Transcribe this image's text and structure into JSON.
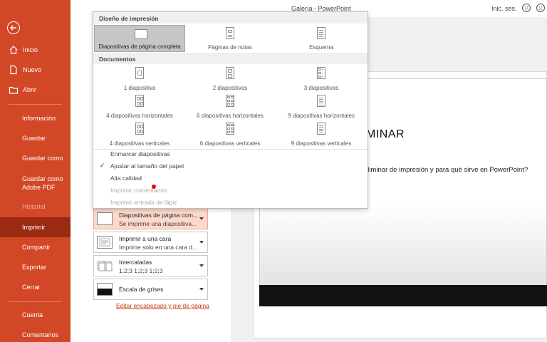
{
  "window": {
    "title": "Galería  -  PowerPoint",
    "signin": "Inic. ses."
  },
  "sidebar": {
    "items": [
      {
        "label": "Inicio"
      },
      {
        "label": "Nuevo"
      },
      {
        "label": "Abrir"
      },
      {
        "label": "Información"
      },
      {
        "label": "Guardar"
      },
      {
        "label": "Guardar como"
      },
      {
        "label": "Guardar como\nAdobe PDF"
      },
      {
        "label": "Historial"
      },
      {
        "label": "Imprimir"
      },
      {
        "label": "Compartir"
      },
      {
        "label": "Exportar"
      },
      {
        "label": "Cerrar"
      },
      {
        "label": "Cuenta"
      },
      {
        "label": "Comentarios"
      }
    ]
  },
  "popup": {
    "layout_header": "Diseño de impresión",
    "layouts": [
      {
        "label": "Diapositivas de página completa",
        "selected": true
      },
      {
        "label": "Páginas de notas"
      },
      {
        "label": "Esquema"
      }
    ],
    "documents_header": "Documentos",
    "handouts": [
      {
        "label": "1 diapositiva"
      },
      {
        "label": "2 diapositivas"
      },
      {
        "label": "3 diapositivas"
      },
      {
        "label": "4 diapositivas horizontales"
      },
      {
        "label": "6 diapositivas horizontales"
      },
      {
        "label": "9 diapositivas horizontales"
      },
      {
        "label": "4 diapositivas verticales"
      },
      {
        "label": "6 diapositivas verticales"
      },
      {
        "label": "9 diapositivas verticales"
      }
    ],
    "options": [
      {
        "label": "Enmarcar diapositivas",
        "checked": false,
        "enabled": true
      },
      {
        "label": "Ajustar al tamaño del papel",
        "checked": true,
        "enabled": true
      },
      {
        "label": "Alta calidad",
        "checked": false,
        "enabled": true
      },
      {
        "label": "Imprimir comentarios",
        "checked": false,
        "enabled": false
      },
      {
        "label": "Imprimir entrada de lápiz",
        "checked": false,
        "enabled": false
      }
    ]
  },
  "settings": {
    "layout": {
      "line1": "Diapositivas de página com...",
      "line2": "Se imprime una diapositiva..."
    },
    "sides": {
      "line1": "Imprimir a una cara",
      "line2": "Imprime solo en una cara d..."
    },
    "collate": {
      "line1": "Intercaladas",
      "line2": "1;2;3   1;2;3   1;2;3"
    },
    "color": {
      "line1": "Escala de grises"
    },
    "edit_link": "Editar encabezado y pie de página"
  },
  "preview": {
    "slide_title": "MINAR",
    "slide_text": "eliminar de impresión y para qué sirve en PowerPoint?"
  },
  "colors": {
    "accent": "#d24726",
    "active": "#9a2a12"
  }
}
